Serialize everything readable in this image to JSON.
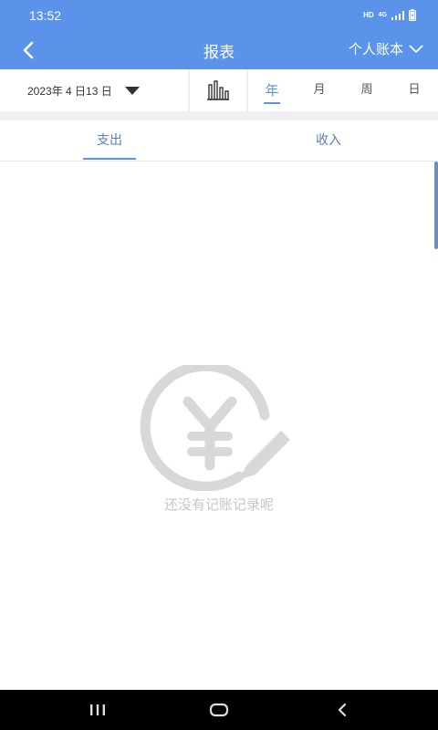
{
  "status_bar": {
    "time": "13:52",
    "hd": "HD",
    "network": "4G"
  },
  "app_bar": {
    "title": "报表",
    "book_selector": "个人账本"
  },
  "filter": {
    "date": "2023年 4 日13 日",
    "periods": [
      "年",
      "月",
      "周",
      "日"
    ],
    "active_period": "年"
  },
  "type_tabs": {
    "expense": "支出",
    "income": "收入",
    "active": "支出"
  },
  "empty_state": {
    "message": "还没有记账记录呢"
  },
  "colors": {
    "primary": "#5b93ea",
    "empty_gray": "#d8d8d8"
  }
}
